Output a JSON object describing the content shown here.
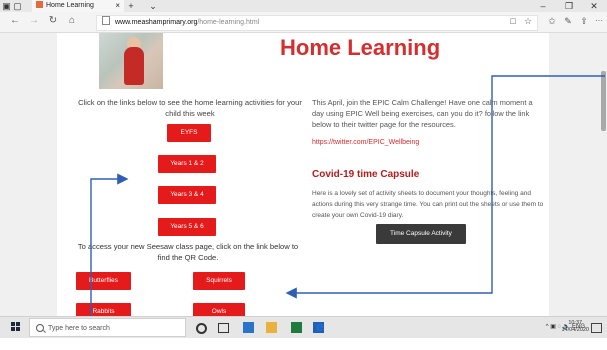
{
  "browser": {
    "tab_title": "Home Learning",
    "tab_close": "×",
    "new_tab": "+",
    "tab_menu": "⌄",
    "window_controls": [
      "–",
      "❐",
      "✕"
    ],
    "url_domain": "www.meashamprimary.org",
    "url_path": "/home-learning.html",
    "nav_icons": [
      "←",
      "→",
      "↻",
      "⌂"
    ],
    "toolbar_icons": [
      "□",
      "☆",
      "✩",
      "✎",
      "⇪",
      "···"
    ]
  },
  "page": {
    "heading": "Home Learning",
    "intro": "Click on the links below to see the home learning activities for your child this week",
    "year_buttons": [
      "EYFS",
      "Years 1 & 2",
      "Years 3 & 4",
      "Years 5 & 6"
    ],
    "seesaw_text": "To access your new Seesaw class page, click on the link below to find the QR Code.",
    "class_buttons": [
      "Butterflies",
      "Squirrels",
      "Rabbits",
      "Owls"
    ],
    "calm_text": "This April, join the EPIC Calm Challenge! Have one calm moment a day using EPIC Well being exercises, can you do it? follow the link below to their twitter page for the resources.",
    "twitter_link": "https://twitter.com/EPIC_Wellbeing",
    "capsule_heading": "Covid-19 time Capsule",
    "capsule_text": "Here is a lovely set of activity sheets to document your thoughts, feeling and actions during this very strange time. You can print out the sheets or use them to create your own Covid-19 diary.",
    "capsule_button": "Time Capsule Activity"
  },
  "taskbar": {
    "search_placeholder": "Type here to search",
    "tray_text": "^ ▣ ◌ 🔈 ENG",
    "time": "10:37",
    "date": "14/04/2020"
  },
  "colors": {
    "accent_red": "#e51b1b",
    "heading_red": "#d32f2f",
    "arrow_blue": "#2f5fb5"
  }
}
